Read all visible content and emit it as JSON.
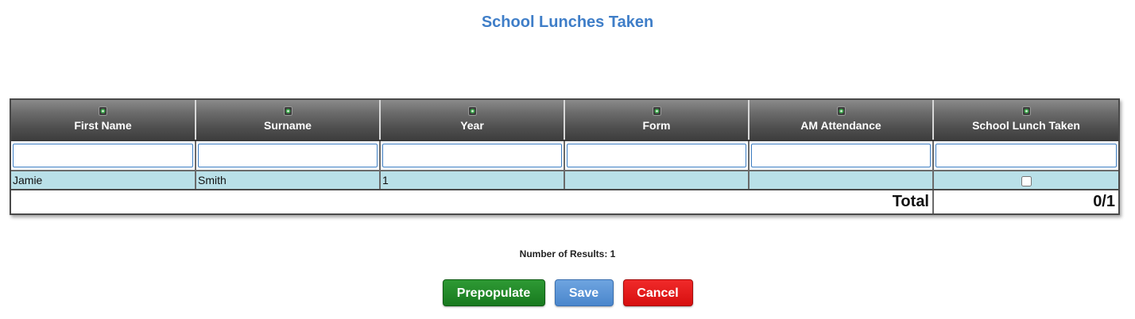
{
  "page": {
    "title": "School Lunches Taken"
  },
  "grid": {
    "columns": [
      {
        "label": "First Name",
        "sort_icon": "sort-icon"
      },
      {
        "label": "Surname",
        "sort_icon": "sort-icon"
      },
      {
        "label": "Year",
        "sort_icon": "sort-icon"
      },
      {
        "label": "Form",
        "sort_icon": "sort-icon"
      },
      {
        "label": "AM Attendance",
        "sort_icon": "sort-icon"
      },
      {
        "label": "School Lunch Taken",
        "sort_icon": "sort-icon"
      }
    ],
    "filters": [
      "",
      "",
      "",
      "",
      "",
      ""
    ],
    "rows": [
      {
        "first_name": "Jamie",
        "surname": "Smith",
        "year": "1",
        "form": "",
        "am_attendance": "",
        "school_lunch_taken": false
      }
    ],
    "total": {
      "label": "Total",
      "value": "0/1"
    }
  },
  "results": {
    "text": "Number of Results: 1"
  },
  "buttons": {
    "prepopulate": "Prepopulate",
    "save": "Save",
    "cancel": "Cancel"
  },
  "colors": {
    "title": "#3f7ec8",
    "row_highlight": "#b9e0e8",
    "prepopulate": "#187a1f",
    "save": "#4a86cc",
    "cancel": "#d70f0f"
  }
}
